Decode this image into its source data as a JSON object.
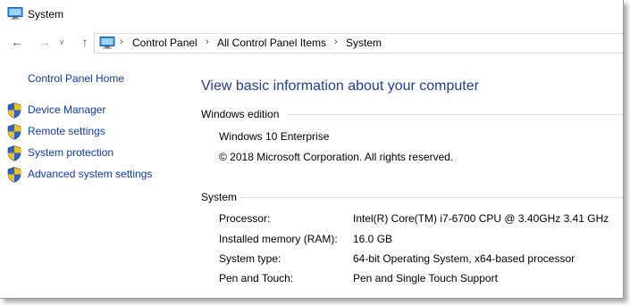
{
  "window": {
    "title": "System"
  },
  "address": {
    "crumbs": [
      "Control Panel",
      "All Control Panel Items",
      "System"
    ]
  },
  "left": {
    "home": "Control Panel Home",
    "tasks": [
      "Device Manager",
      "Remote settings",
      "System protection",
      "Advanced system settings"
    ]
  },
  "main": {
    "heading": "View basic information about your computer",
    "edition": {
      "title": "Windows edition",
      "name": "Windows 10 Enterprise",
      "copyright": "© 2018 Microsoft Corporation. All rights reserved."
    },
    "system": {
      "title": "System",
      "rows": [
        {
          "label": "Processor:",
          "value": "Intel(R) Core(TM) i7-6700 CPU @ 3.40GHz   3.41 GHz"
        },
        {
          "label": "Installed memory (RAM):",
          "value": "16.0 GB"
        },
        {
          "label": "System type:",
          "value": "64-bit Operating System, x64-based processor"
        },
        {
          "label": "Pen and Touch:",
          "value": "Pen and Single Touch Support"
        }
      ]
    }
  },
  "colors": {
    "link": "#0e3bb3",
    "heading": "#1e3da0"
  },
  "icons": {
    "window": "computer-icon",
    "task": "uac-shield-icon"
  }
}
